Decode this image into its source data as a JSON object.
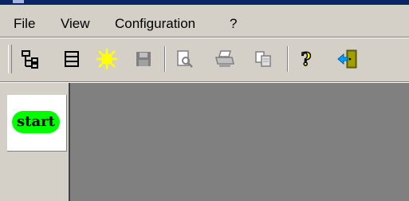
{
  "menu": {
    "file": "File",
    "view": "View",
    "configuration": "Configuration",
    "help": "?"
  },
  "toolbar": {
    "buttons": [
      {
        "icon": "tree-structure-icon",
        "label": "Hierarchy"
      },
      {
        "icon": "list-icon",
        "label": "List"
      },
      {
        "icon": "new-sun-icon",
        "label": "New"
      },
      {
        "icon": "save-icon",
        "label": "Save"
      },
      {
        "icon": "print-preview-icon",
        "label": "Print preview"
      },
      {
        "icon": "print-icon",
        "label": "Print"
      },
      {
        "icon": "copy-icon",
        "label": "Copy"
      },
      {
        "icon": "help-icon",
        "label": "Help"
      },
      {
        "icon": "exit-icon",
        "label": "Exit"
      }
    ]
  },
  "palette": {
    "start_label": "start",
    "start_color": "#00ff00"
  },
  "colors": {
    "canvas": "#808080",
    "chrome": "#d4d0c8"
  }
}
